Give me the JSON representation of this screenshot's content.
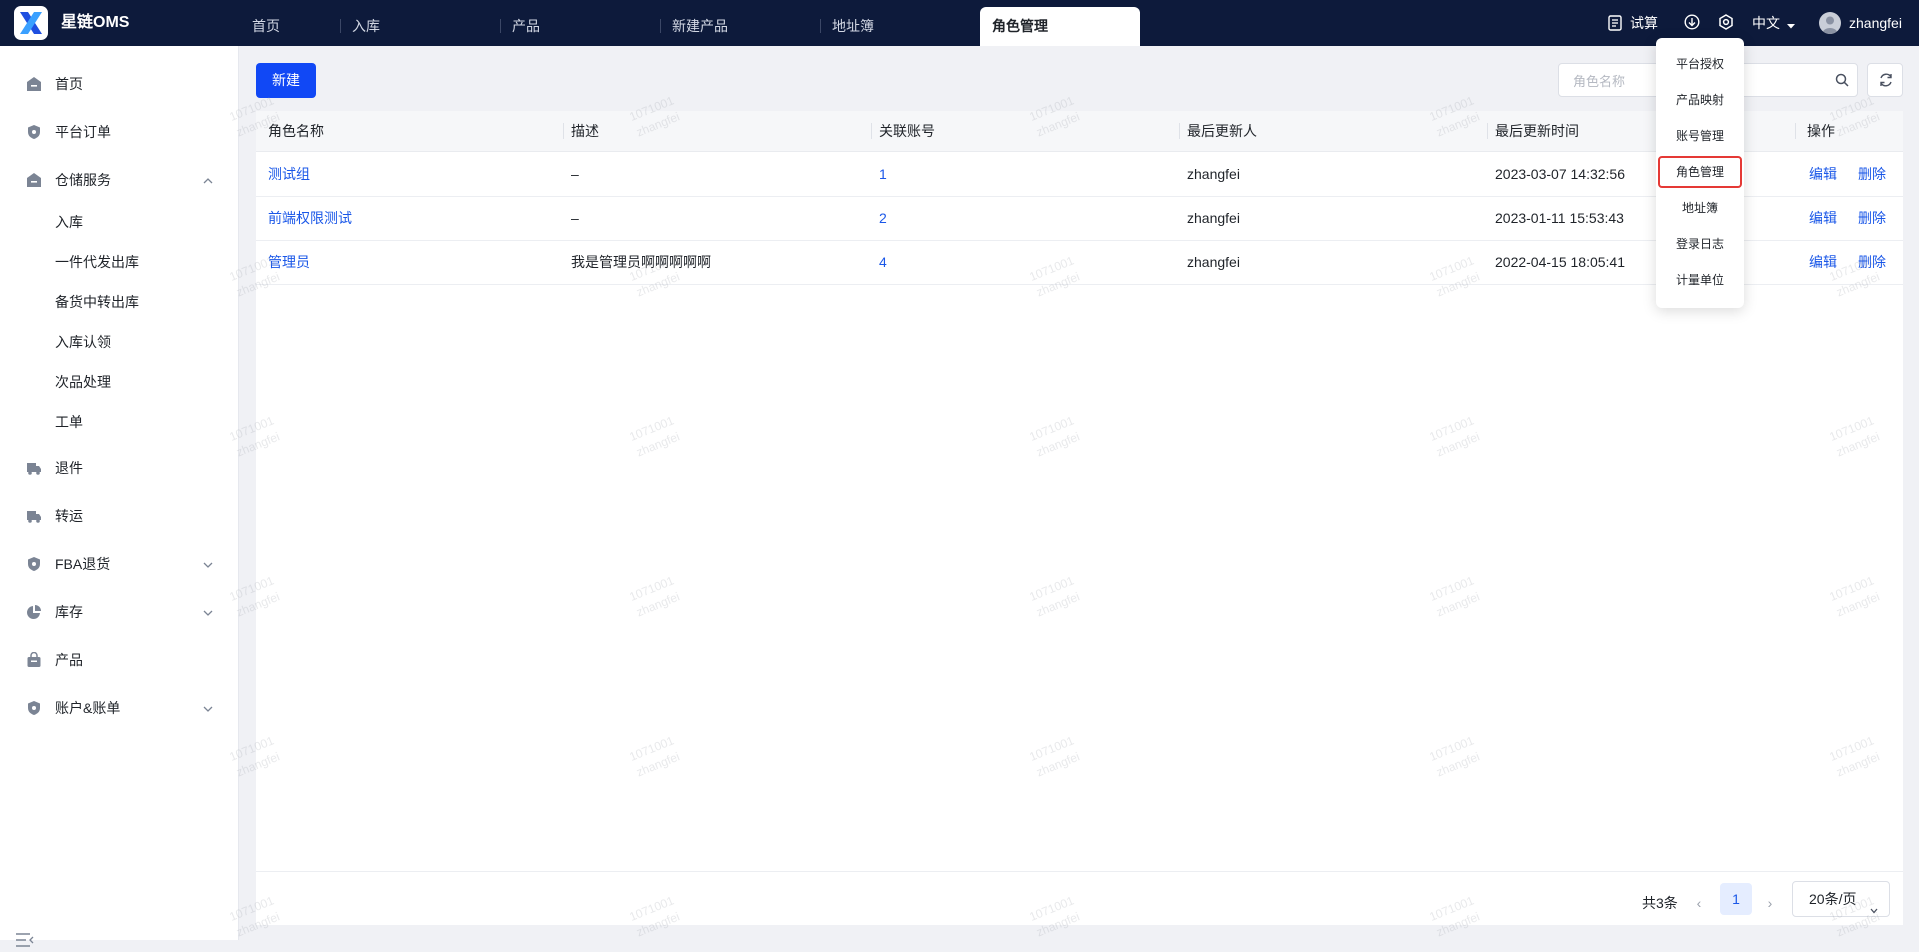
{
  "app": {
    "title": "星链OMS"
  },
  "tabs": [
    "首页",
    "入库",
    "产品",
    "新建产品",
    "地址簿",
    "角色管理"
  ],
  "header": {
    "trial": "试算",
    "language": "中文",
    "user": "zhangfei"
  },
  "settings_menu": [
    "平台授权",
    "产品映射",
    "账号管理",
    "角色管理",
    "地址簿",
    "登录日志",
    "计量单位"
  ],
  "sidebar": {
    "items": [
      {
        "label": "首页"
      },
      {
        "label": "平台订单"
      },
      {
        "label": "仓储服务"
      },
      {
        "label": "退件"
      },
      {
        "label": "转运"
      },
      {
        "label": "FBA退货"
      },
      {
        "label": "库存"
      },
      {
        "label": "产品"
      },
      {
        "label": "账户&账单"
      }
    ],
    "sub_items": [
      "入库",
      "一件代发出库",
      "备货中转出库",
      "入库认领",
      "次品处理",
      "工单"
    ]
  },
  "toolbar": {
    "new_label": "新建",
    "search_placeholder": "角色名称"
  },
  "table": {
    "columns": [
      "角色名称",
      "描述",
      "关联账号",
      "最后更新人",
      "最后更新时间",
      "操作"
    ],
    "rows": [
      {
        "name": "测试组",
        "desc": "–",
        "accounts": "1",
        "updater": "zhangfei",
        "time": "2023-03-07 14:32:56"
      },
      {
        "name": "前端权限测试",
        "desc": "–",
        "accounts": "2",
        "updater": "zhangfei",
        "time": "2023-01-11 15:53:43"
      },
      {
        "name": "管理员",
        "desc": "我是管理员啊啊啊啊啊",
        "accounts": "4",
        "updater": "zhangfei",
        "time": "2022-04-15 18:05:41"
      }
    ],
    "edit_label": "编辑",
    "delete_label": "删除"
  },
  "pagination": {
    "total": "共3条",
    "page": "1",
    "page_size": "20条/页"
  },
  "watermark": {
    "line1": "1071001",
    "line2": "zhangfei"
  },
  "colors": {
    "topbar": "#0d1a3b",
    "primary": "#1148f5",
    "link": "#1a57e8",
    "highlight": "#e53935"
  }
}
